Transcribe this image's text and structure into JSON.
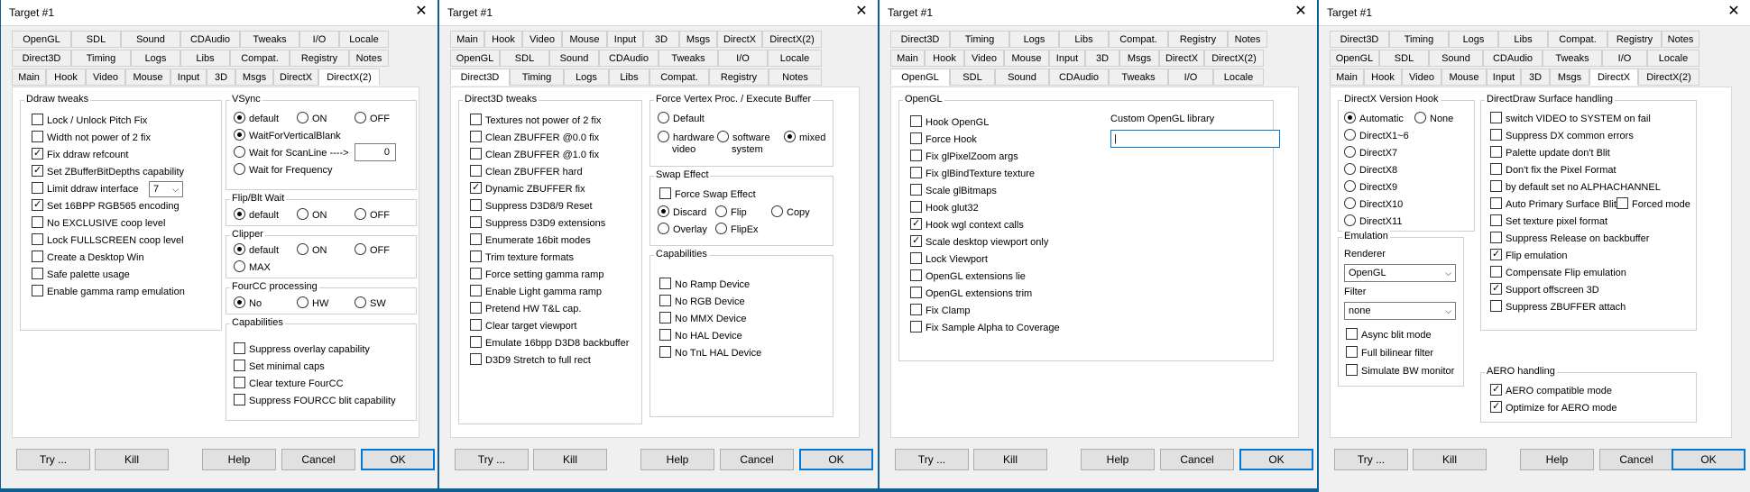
{
  "title": "Target #1",
  "buttons": {
    "try": "Try ...",
    "kill": "Kill",
    "help": "Help",
    "cancel": "Cancel",
    "ok": "OK"
  },
  "d1": {
    "tabs_row1": [
      "OpenGL",
      "SDL",
      "Sound",
      "CDAudio",
      "Tweaks",
      "I/O",
      "Locale"
    ],
    "tabs_row2": [
      "Direct3D",
      "Timing",
      "Logs",
      "Libs",
      "Compat.",
      "Registry",
      "Notes"
    ],
    "tabs_row3": [
      "Main",
      "Hook",
      "Video",
      "Mouse",
      "Input",
      "3D",
      "Msgs",
      "DirectX",
      "DirectX(2)"
    ],
    "ddraw": {
      "title": "Ddraw tweaks",
      "items": [
        {
          "label": "Lock / Unlock Pitch Fix",
          "checked": false
        },
        {
          "label": "Width not power of 2 fix",
          "checked": false
        },
        {
          "label": "Fix ddraw refcount",
          "checked": true
        },
        {
          "label": "Set ZBufferBitDepths capability",
          "checked": true
        },
        {
          "label": "Limit ddraw interface",
          "checked": false
        },
        {
          "label": "Set 16BPP RGB565 encoding",
          "checked": true
        },
        {
          "label": "No EXCLUSIVE coop level",
          "checked": false
        },
        {
          "label": "Lock FULLSCREEN coop level",
          "checked": false
        },
        {
          "label": "Create a Desktop Win",
          "checked": false
        },
        {
          "label": "Safe palette usage",
          "checked": false
        },
        {
          "label": "Enable gamma ramp emulation",
          "checked": false
        }
      ],
      "limit_value": "7"
    },
    "vsync": {
      "title": "VSync",
      "default": "default",
      "on": "ON",
      "off": "OFF",
      "wait_vb": "WaitForVerticalBlank",
      "wait_scan": "Wait for ScanLine ---->",
      "scan_value": "0",
      "wait_freq": "Wait for Frequency"
    },
    "flip": {
      "title": "Flip/Blt Wait",
      "default": "default",
      "on": "ON",
      "off": "OFF"
    },
    "clipper": {
      "title": "Clipper",
      "default": "default",
      "on": "ON",
      "off": "OFF",
      "max": "MAX"
    },
    "fourcc": {
      "title": "FourCC processing",
      "no": "No",
      "hw": "HW",
      "sw": "SW"
    },
    "caps": {
      "title": "Capabilities",
      "items": [
        "Suppress overlay capability",
        "Set minimal caps",
        "Clear texture FourCC",
        "Suppress FOURCC blit capability"
      ]
    }
  },
  "d2": {
    "tabs_row1": [
      "Main",
      "Hook",
      "Video",
      "Mouse",
      "Input",
      "3D",
      "Msgs",
      "DirectX",
      "DirectX(2)"
    ],
    "tabs_row2": [
      "OpenGL",
      "SDL",
      "Sound",
      "CDAudio",
      "Tweaks",
      "I/O",
      "Locale"
    ],
    "tabs_row3": [
      "Direct3D",
      "Timing",
      "Logs",
      "Libs",
      "Compat.",
      "Registry",
      "Notes"
    ],
    "d3d": {
      "title": "Direct3D tweaks",
      "items": [
        {
          "label": "Textures not power of 2 fix",
          "checked": false
        },
        {
          "label": "Clean ZBUFFER @0.0 fix",
          "checked": false
        },
        {
          "label": "Clean ZBUFFER @1.0 fix",
          "checked": false
        },
        {
          "label": "Clean ZBUFFER hard",
          "checked": false
        },
        {
          "label": "Dynamic ZBUFFER fix",
          "checked": true
        },
        {
          "label": "Suppress D3D8/9 Reset",
          "checked": false
        },
        {
          "label": "Suppress D3D9 extensions",
          "checked": false
        },
        {
          "label": "Enumerate 16bit modes",
          "checked": false
        },
        {
          "label": "Trim texture formats",
          "checked": false
        },
        {
          "label": "Force setting gamma ramp",
          "checked": false
        },
        {
          "label": "Enable Light gamma ramp",
          "checked": false
        },
        {
          "label": "Pretend HW T&L cap.",
          "checked": false
        },
        {
          "label": "Clear target viewport",
          "checked": false
        },
        {
          "label": "Emulate 16bpp D3D8 backbuffer",
          "checked": false
        },
        {
          "label": "D3D9 Stretch to full rect",
          "checked": false
        }
      ]
    },
    "fvp": {
      "title": "Force Vertex Proc. / Execute Buffer",
      "default": "Default",
      "hw1": "hardware",
      "hw2": "video",
      "sw1": "software",
      "sw2": "system",
      "mixed": "mixed"
    },
    "swap": {
      "title": "Swap Effect",
      "force": "Force Swap Effect",
      "discard": "Discard",
      "flip": "Flip",
      "copy": "Copy",
      "overlay": "Overlay",
      "flipex": "FlipEx"
    },
    "caps": {
      "title": "Capabilities",
      "items": [
        "No Ramp Device",
        "No RGB Device",
        "No MMX Device",
        "No HAL Device",
        "No TnL HAL Device"
      ]
    }
  },
  "d3": {
    "tabs_row1": [
      "Direct3D",
      "Timing",
      "Logs",
      "Libs",
      "Compat.",
      "Registry",
      "Notes"
    ],
    "tabs_row2": [
      "Main",
      "Hook",
      "Video",
      "Mouse",
      "Input",
      "3D",
      "Msgs",
      "DirectX",
      "DirectX(2)"
    ],
    "tabs_row3": [
      "OpenGL",
      "SDL",
      "Sound",
      "CDAudio",
      "Tweaks",
      "I/O",
      "Locale"
    ],
    "ogl": {
      "title": "OpenGL",
      "items": [
        {
          "label": "Hook OpenGL",
          "checked": false
        },
        {
          "label": "Force Hook",
          "checked": false
        },
        {
          "label": "Fix glPixelZoom args",
          "checked": false
        },
        {
          "label": "Fix glBindTexture texture",
          "checked": false
        },
        {
          "label": "Scale glBitmaps",
          "checked": false
        },
        {
          "label": "Hook glut32",
          "checked": false
        },
        {
          "label": "Hook wgl context calls",
          "checked": true
        },
        {
          "label": "Scale desktop viewport only",
          "checked": true
        },
        {
          "label": "Lock Viewport",
          "checked": false
        },
        {
          "label": "OpenGL extensions lie",
          "checked": false
        },
        {
          "label": "OpenGL extensions trim",
          "checked": false
        },
        {
          "label": "Fix Clamp",
          "checked": false
        },
        {
          "label": "Fix Sample Alpha to Coverage",
          "checked": false
        }
      ],
      "custom_lib_label": "Custom OpenGL library",
      "custom_lib_value": "|"
    }
  },
  "d4": {
    "tabs_row1": [
      "Direct3D",
      "Timing",
      "Logs",
      "Libs",
      "Compat.",
      "Registry",
      "Notes"
    ],
    "tabs_row2": [
      "OpenGL",
      "SDL",
      "Sound",
      "CDAudio",
      "Tweaks",
      "I/O",
      "Locale"
    ],
    "tabs_row3": [
      "Main",
      "Hook",
      "Video",
      "Mouse",
      "Input",
      "3D",
      "Msgs",
      "DirectX",
      "DirectX(2)"
    ],
    "dxhook": {
      "title": "DirectX Version Hook",
      "automatic": "Automatic",
      "none": "None",
      "versions": [
        "DirectX1~6",
        "DirectX7",
        "DirectX8",
        "DirectX9",
        "DirectX10",
        "DirectX11"
      ]
    },
    "emul": {
      "title": "Emulation",
      "renderer_label": "Renderer",
      "renderer_value": "OpenGL",
      "filter_label": "Filter",
      "filter_value": "none",
      "items": [
        {
          "label": "Async blit mode",
          "checked": false
        },
        {
          "label": "Full bilinear filter",
          "checked": false
        },
        {
          "label": "Simulate BW monitor",
          "checked": false
        }
      ]
    },
    "surf": {
      "title": "DirectDraw Surface handling",
      "items": [
        {
          "label": "switch VIDEO to SYSTEM on fail",
          "checked": false
        },
        {
          "label": "Suppress DX common errors",
          "checked": false
        },
        {
          "label": "Palette update don't Blit",
          "checked": false
        },
        {
          "label": "Don't fix the Pixel Format",
          "checked": false
        },
        {
          "label": "by default set no ALPHACHANNEL",
          "checked": false
        },
        {
          "label": "Auto Primary Surface Blit",
          "checked": false
        },
        {
          "label": "Set texture pixel format",
          "checked": false
        },
        {
          "label": "Suppress Release on backbuffer",
          "checked": false
        },
        {
          "label": "Flip emulation",
          "checked": true
        },
        {
          "label": "Compensate Flip emulation",
          "checked": false
        },
        {
          "label": "Support offscreen 3D",
          "checked": true
        },
        {
          "label": "Suppress ZBUFFER attach",
          "checked": false
        }
      ],
      "forced_mode": "Forced mode"
    },
    "aero": {
      "title": "AERO handling",
      "items": [
        {
          "label": "AERO compatible mode",
          "checked": true
        },
        {
          "label": "Optimize for AERO mode",
          "checked": true
        }
      ]
    }
  }
}
